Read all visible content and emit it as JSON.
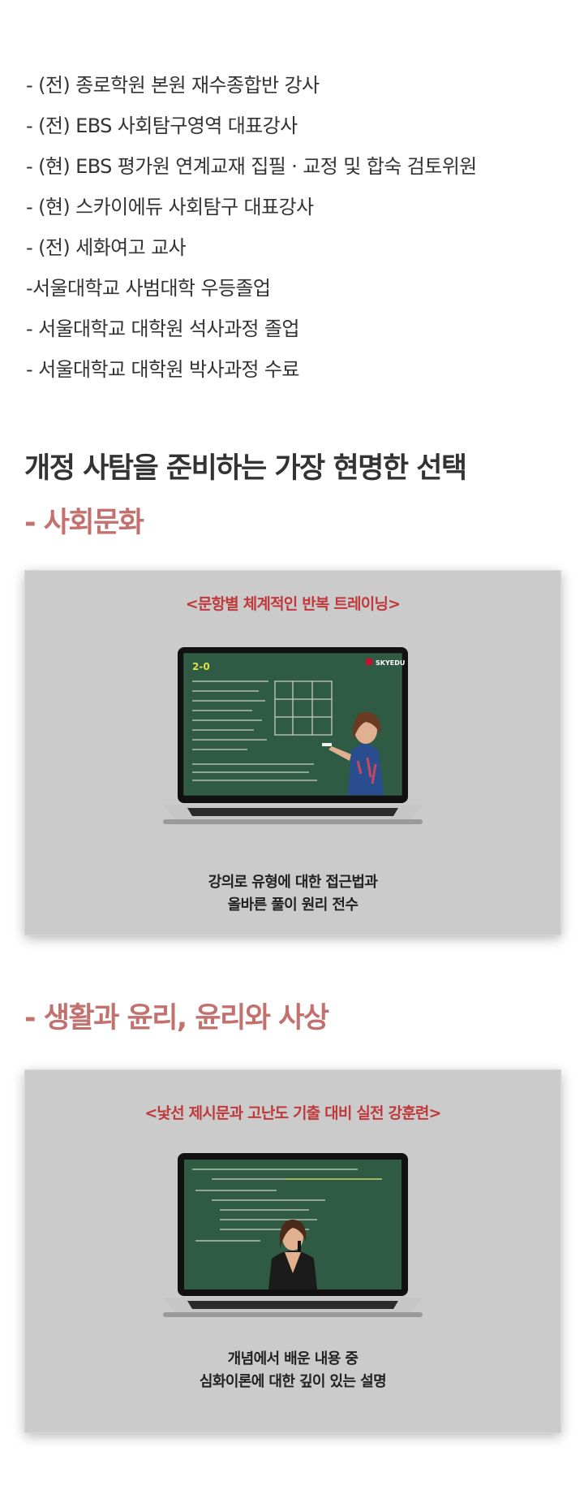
{
  "bio": [
    "- (전) 종로학원 본원 재수종합반 강사",
    "- (전) EBS 사회탐구영역 대표강사",
    "- (현) EBS 평가원 연계교재 집필 · 교정 및 합숙 검토위원",
    "- (현) 스카이에듀 사회탐구 대표강사",
    "- (전) 세화여고 교사",
    "-서울대학교 사범대학 우등졸업",
    "- 서울대학교 대학원 석사과정 졸업",
    "- 서울대학교 대학원 박사과정 수료"
  ],
  "main_heading": "개정 사탐을 준비하는 가장 현명한 선택",
  "sections": [
    {
      "subheading": "- 사회문화",
      "card_title": "<문항별 체계적인 반복 트레이닝>",
      "desc_line1": "강의로 유형에 대한 접근법과",
      "desc_line2": "올바른 풀이 원리 전수",
      "brand": "SKYEDU"
    },
    {
      "subheading": "- 생활과 윤리, 윤리와 사상",
      "card_title": "<낯선 제시문과 고난도 기출 대비 실전 강훈련>",
      "desc_line1": "개념에서 배운 내용 중",
      "desc_line2": "심화이론에 대한 깊이 있는 설명"
    }
  ],
  "colors": {
    "accent": "#c2716e",
    "card_title": "#c0393b",
    "card_bg": "#cbcbcb",
    "chalkboard": "#2f5a43",
    "brand_red": "#c8102e"
  }
}
